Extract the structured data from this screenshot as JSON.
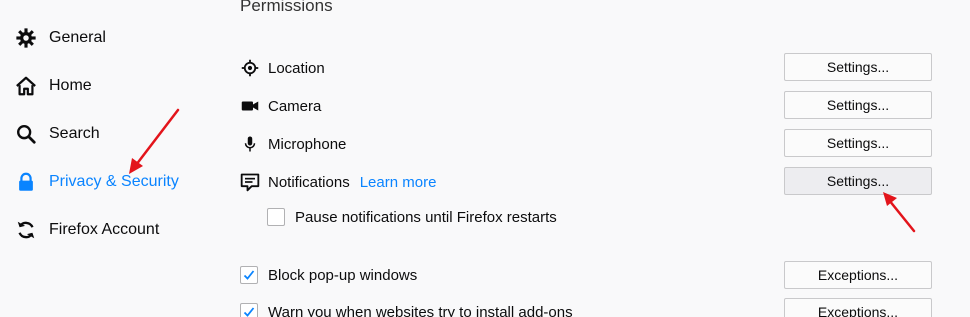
{
  "sidebar": {
    "items": [
      {
        "label": "General",
        "icon": "gear-icon"
      },
      {
        "label": "Home",
        "icon": "home-icon"
      },
      {
        "label": "Search",
        "icon": "search-icon"
      },
      {
        "label": "Privacy & Security",
        "icon": "lock-icon",
        "selected": true
      },
      {
        "label": "Firefox Account",
        "icon": "sync-icon"
      }
    ]
  },
  "main": {
    "section_title": "Permissions",
    "permissions": [
      {
        "label": "Location",
        "icon": "location-icon",
        "button": "Settings..."
      },
      {
        "label": "Camera",
        "icon": "camera-icon",
        "button": "Settings..."
      },
      {
        "label": "Microphone",
        "icon": "microphone-icon",
        "button": "Settings..."
      },
      {
        "label": "Notifications",
        "icon": "notifications-icon",
        "button": "Settings...",
        "learn_more": "Learn more"
      }
    ],
    "pause_notifications": {
      "label": "Pause notifications until Firefox restarts",
      "checked": false
    },
    "block_popups": {
      "label": "Block pop-up windows",
      "checked": true,
      "button": "Exceptions..."
    },
    "warn_addons": {
      "label": "Warn you when websites try to install add-ons",
      "checked": true,
      "button": "Exceptions..."
    }
  },
  "colors": {
    "accent": "#0a84ff",
    "annotation_arrow": "#e3141b"
  }
}
